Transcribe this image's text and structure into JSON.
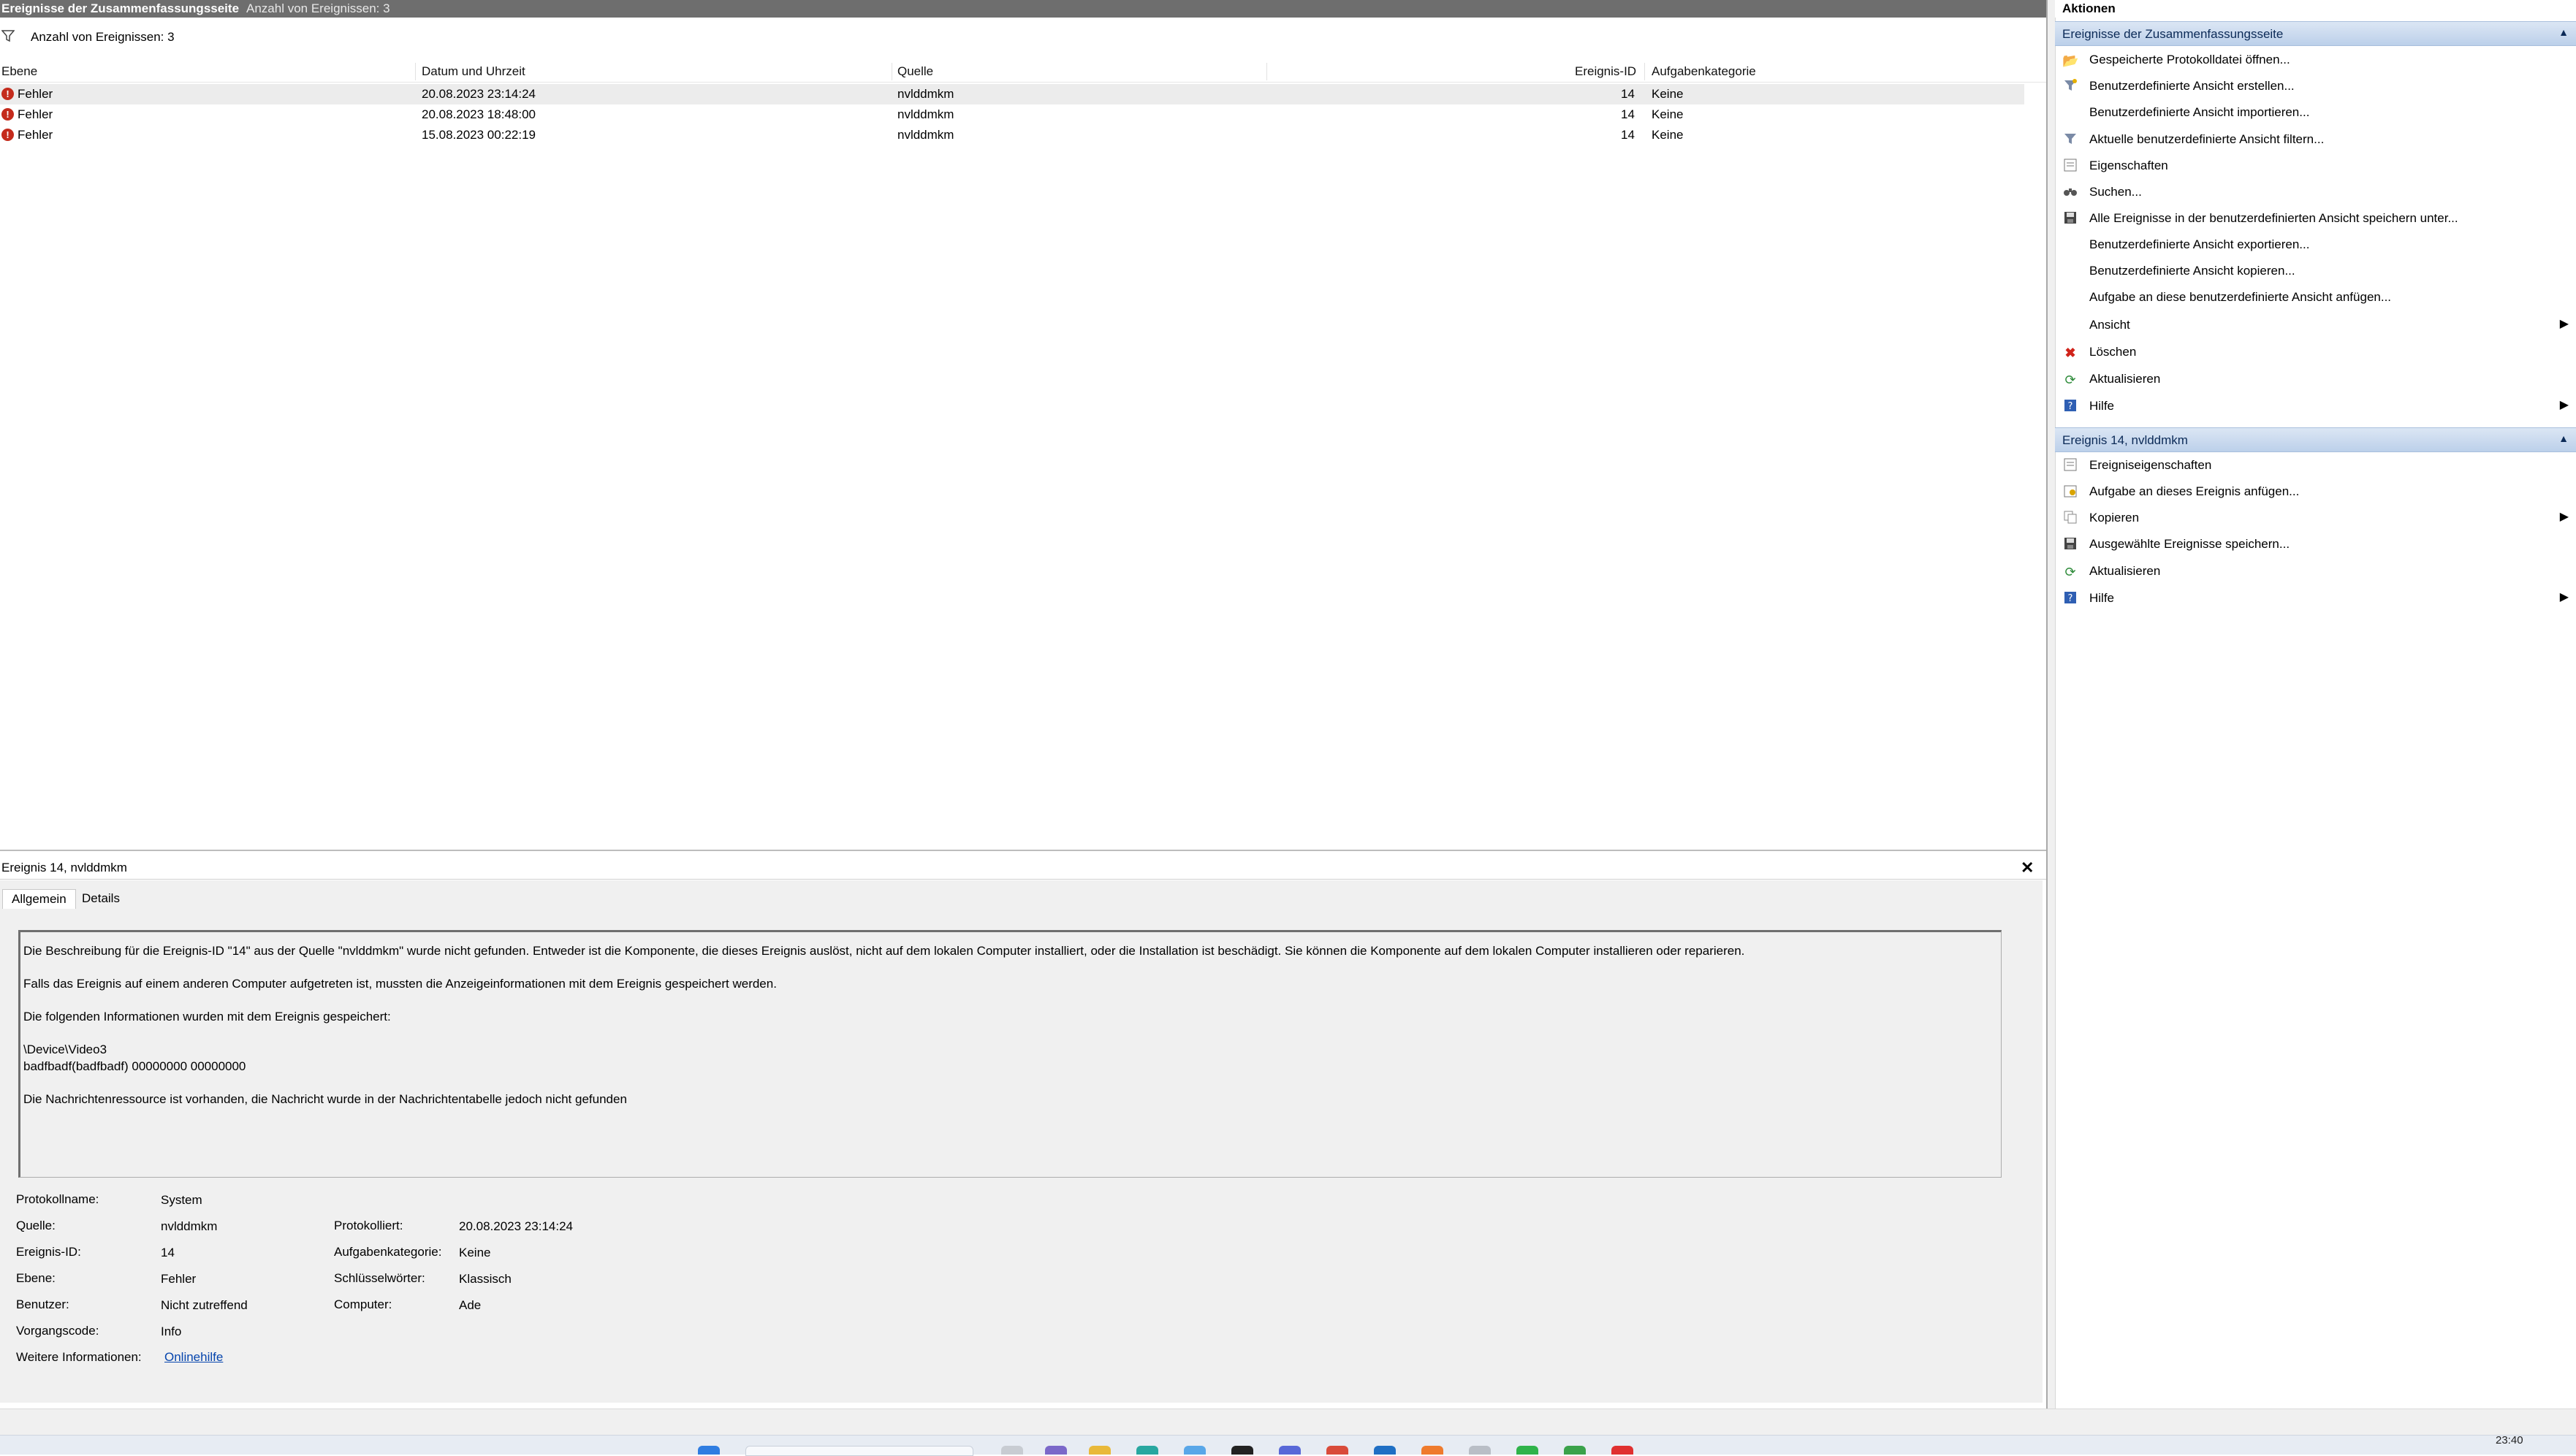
{
  "header": {
    "title": "Ereignisse der Zusammenfassungsseite",
    "count_label": "Anzahl von Ereignissen: 3"
  },
  "filter_bar": {
    "label": "Anzahl von Ereignissen: 3",
    "icon": "funnel-icon"
  },
  "table": {
    "columns": [
      "Ebene",
      "Datum und Uhrzeit",
      "Quelle",
      "Ereignis-ID",
      "Aufgabenkategorie"
    ],
    "rows": [
      {
        "level": "Fehler",
        "datetime": "20.08.2023 23:14:24",
        "source": "nvlddmkm",
        "event_id": "14",
        "category": "Keine"
      },
      {
        "level": "Fehler",
        "datetime": "20.08.2023 18:48:00",
        "source": "nvlddmkm",
        "event_id": "14",
        "category": "Keine"
      },
      {
        "level": "Fehler",
        "datetime": "15.08.2023 00:22:19",
        "source": "nvlddmkm",
        "event_id": "14",
        "category": "Keine"
      }
    ]
  },
  "detail": {
    "title": "Ereignis 14, nvlddmkm",
    "close_glyph": "✕",
    "tabs": [
      "Allgemein",
      "Details"
    ],
    "description": [
      "Die Beschreibung für die Ereignis-ID \"14\" aus der Quelle \"nvlddmkm\" wurde nicht gefunden. Entweder ist die Komponente, die dieses Ereignis auslöst, nicht auf dem lokalen Computer installiert, oder die Installation ist beschädigt. Sie können die Komponente auf dem lokalen Computer installieren oder reparieren.",
      "Falls das Ereignis auf einem anderen Computer aufgetreten ist, mussten die Anzeigeinformationen mit dem Ereignis gespeichert werden.",
      "Die folgenden Informationen wurden mit dem Ereignis gespeichert:",
      "\\Device\\Video3",
      "badfbadf(badfbadf) 00000000 00000000",
      "Die Nachrichtenressource ist vorhanden, die Nachricht wurde in der Nachrichtentabelle jedoch nicht gefunden"
    ],
    "fields": {
      "log_name_label": "Protokollname:",
      "log_name": "System",
      "source_label": "Quelle:",
      "source": "nvlddmkm",
      "logged_label": "Protokolliert:",
      "logged": "20.08.2023 23:14:24",
      "event_id_label": "Ereignis-ID:",
      "event_id": "14",
      "task_cat_label": "Aufgabenkategorie:",
      "task_cat": "Keine",
      "level_label": "Ebene:",
      "level": "Fehler",
      "keywords_label": "Schlüsselwörter:",
      "keywords": "Klassisch",
      "user_label": "Benutzer:",
      "user": "Nicht zutreffend",
      "computer_label": "Computer:",
      "computer": "Ade",
      "opcode_label": "Vorgangscode:",
      "opcode": "Info",
      "more_info_label": "Weitere Informationen:",
      "more_info_link": "Onlinehilfe"
    }
  },
  "actions": {
    "title": "Aktionen",
    "section1": {
      "title": "Ereignisse der Zusammenfassungsseite",
      "items": [
        {
          "label": "Gespeicherte Protokolldatei öffnen...",
          "icon": "folder-open-icon"
        },
        {
          "label": "Benutzerdefinierte Ansicht erstellen...",
          "icon": "funnel-new-icon"
        },
        {
          "label": "Benutzerdefinierte Ansicht importieren...",
          "icon": ""
        },
        {
          "label": "Aktuelle benutzerdefinierte Ansicht filtern...",
          "icon": "funnel-icon"
        },
        {
          "label": "Eigenschaften",
          "icon": "properties-icon"
        },
        {
          "label": "Suchen...",
          "icon": "binoculars-icon"
        },
        {
          "label": "Alle Ereignisse in der benutzerdefinierten Ansicht speichern unter...",
          "icon": "save-icon"
        },
        {
          "label": "Benutzerdefinierte Ansicht exportieren...",
          "icon": ""
        },
        {
          "label": "Benutzerdefinierte Ansicht kopieren...",
          "icon": ""
        },
        {
          "label": "Aufgabe an diese benutzerdefinierte Ansicht anfügen...",
          "icon": ""
        },
        {
          "label": "Ansicht",
          "icon": "",
          "submenu": true
        },
        {
          "label": "Löschen",
          "icon": "delete-icon"
        },
        {
          "label": "Aktualisieren",
          "icon": "refresh-icon"
        },
        {
          "label": "Hilfe",
          "icon": "help-icon",
          "submenu": true
        }
      ]
    },
    "section2": {
      "title": "Ereignis 14, nvlddmkm",
      "items": [
        {
          "label": "Ereigniseigenschaften",
          "icon": "event-properties-icon"
        },
        {
          "label": "Aufgabe an dieses Ereignis anfügen...",
          "icon": "task-icon"
        },
        {
          "label": "Kopieren",
          "icon": "copy-icon",
          "submenu": true
        },
        {
          "label": "Ausgewählte Ereignisse speichern...",
          "icon": "save-icon"
        },
        {
          "label": "Aktualisieren",
          "icon": "refresh-icon"
        },
        {
          "label": "Hilfe",
          "icon": "help-icon",
          "submenu": true
        }
      ]
    }
  },
  "taskbar": {
    "clock": "23:40"
  }
}
